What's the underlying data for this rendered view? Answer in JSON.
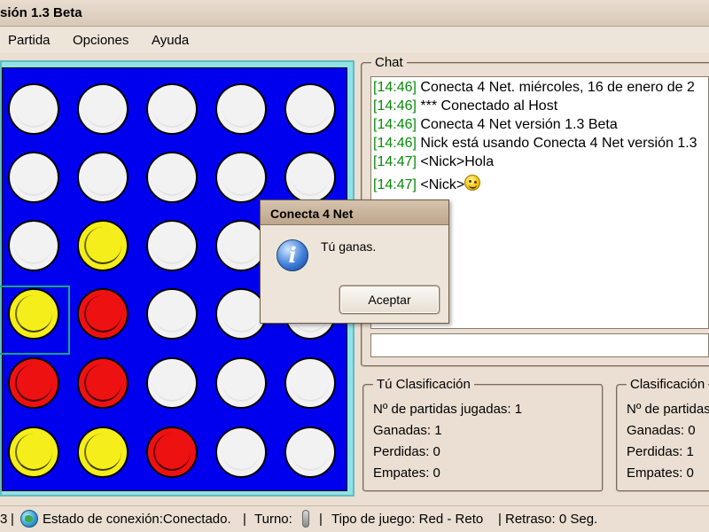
{
  "window": {
    "title": "sión 1.3 Beta"
  },
  "menu": {
    "items": [
      "Partida",
      "Opciones",
      "Ayuda"
    ]
  },
  "colors": {
    "board": "#0000ee",
    "red_piece": "#ee1111",
    "yellow_piece": "#f5ee1a",
    "empty_cell": "#f2f2f2",
    "chat_time": "#0a8a0a"
  },
  "board": {
    "rows": [
      [
        "white",
        "white",
        "white",
        "white",
        "white"
      ],
      [
        "white",
        "white",
        "white",
        "white",
        "white"
      ],
      [
        "white",
        "yellow",
        "white",
        "white",
        "white"
      ],
      [
        "yellow",
        "red",
        "white",
        "white",
        "white"
      ],
      [
        "red",
        "red",
        "white",
        "white",
        "white"
      ],
      [
        "yellow",
        "yellow",
        "red",
        "white",
        "white"
      ]
    ],
    "highlighted_cell": {
      "row": 3,
      "col": 0
    }
  },
  "chat": {
    "label": "Chat",
    "lines": [
      {
        "time": "[14:46]",
        "text": "Conecta 4 Net. miércoles, 16 de enero de 2"
      },
      {
        "time": "[14:46]",
        "text": "*** Conectado al Host"
      },
      {
        "time": "[14:46]",
        "text": "Conecta 4 Net versión 1.3 Beta"
      },
      {
        "time": "[14:46]",
        "text": "Nick está usando Conecta 4 Net versión 1.3"
      },
      {
        "time": "[14:47]",
        "text": "<Nick>Hola"
      },
      {
        "time": "[14:47]",
        "text": "<Nick>",
        "emoticon": "wink-smiley-icon"
      }
    ],
    "input_value": ""
  },
  "my_stats": {
    "label": "Tú Clasificación",
    "played": "Nº de partidas jugadas: 1",
    "won": "Ganadas: 1",
    "lost": "Perdidas: 0",
    "draws": "Empates: 0"
  },
  "opp_stats": {
    "label": "Clasificación",
    "played": "Nº de partidas",
    "won": "Ganadas: 0",
    "lost": "Perdidas: 1",
    "draws": "Empates: 0"
  },
  "status": {
    "left_fragment": "3",
    "connection": "Estado de conexión:Conectado.",
    "turn": "Turno:",
    "game_type": "Tipo de juego:  Red - Reto",
    "delay": "Retraso: 0 Seg."
  },
  "dialog": {
    "title": "Conecta 4 Net",
    "message": "Tú ganas.",
    "button": "Aceptar"
  }
}
